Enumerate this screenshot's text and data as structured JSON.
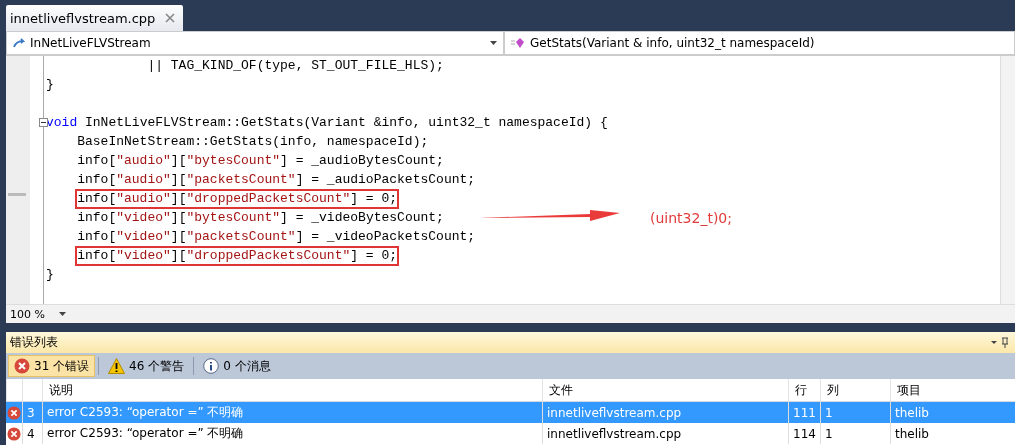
{
  "tab": {
    "title": "innetliveflvstream.cpp"
  },
  "nav": {
    "type_dropdown": "InNetLiveFLVStream",
    "member_dropdown": "GetStats(Variant & info, uint32_t namespaceId)"
  },
  "code": {
    "lines": [
      {
        "kind": "code",
        "boxed": false,
        "tokens": [
          {
            "kind": "plain",
            "text": "             || TAG_KIND_OF(type, ST_OUT_FILE_HLS);"
          }
        ]
      },
      {
        "kind": "code",
        "boxed": false,
        "tokens": [
          {
            "kind": "plain",
            "text": "}"
          }
        ]
      },
      {
        "kind": "blank"
      },
      {
        "kind": "code",
        "boxed": false,
        "collapsible": true,
        "tokens": [
          {
            "kind": "keyword",
            "text": "void"
          },
          {
            "kind": "plain",
            "text": " InNetLiveFLVStream::GetStats(Variant &info, uint32_t namespaceId) {"
          }
        ]
      },
      {
        "kind": "code",
        "boxed": false,
        "tokens": [
          {
            "kind": "plain",
            "text": "    BaseInNetStream::GetStats(info, namespaceId);"
          }
        ]
      },
      {
        "kind": "code",
        "boxed": false,
        "tokens": [
          {
            "kind": "plain",
            "text": "    info["
          },
          {
            "kind": "string",
            "text": "\"audio\""
          },
          {
            "kind": "plain",
            "text": "]["
          },
          {
            "kind": "string",
            "text": "\"bytesCount\""
          },
          {
            "kind": "plain",
            "text": "] = _audioBytesCount;"
          }
        ]
      },
      {
        "kind": "code",
        "boxed": false,
        "tokens": [
          {
            "kind": "plain",
            "text": "    info["
          },
          {
            "kind": "string",
            "text": "\"audio\""
          },
          {
            "kind": "plain",
            "text": "]["
          },
          {
            "kind": "string",
            "text": "\"packetsCount\""
          },
          {
            "kind": "plain",
            "text": "] = _audioPacketsCount;"
          }
        ]
      },
      {
        "kind": "code",
        "boxed": true,
        "tokens": [
          {
            "kind": "plain",
            "text": "info["
          },
          {
            "kind": "string",
            "text": "\"audio\""
          },
          {
            "kind": "plain",
            "text": "]["
          },
          {
            "kind": "string",
            "text": "\"droppedPacketsCount\""
          },
          {
            "kind": "plain",
            "text": "] = 0;"
          }
        ]
      },
      {
        "kind": "code",
        "boxed": false,
        "tokens": [
          {
            "kind": "plain",
            "text": "    info["
          },
          {
            "kind": "string",
            "text": "\"video\""
          },
          {
            "kind": "plain",
            "text": "]["
          },
          {
            "kind": "string",
            "text": "\"bytesCount\""
          },
          {
            "kind": "plain",
            "text": "] = _videoBytesCount;"
          }
        ]
      },
      {
        "kind": "code",
        "boxed": false,
        "tokens": [
          {
            "kind": "plain",
            "text": "    info["
          },
          {
            "kind": "string",
            "text": "\"video\""
          },
          {
            "kind": "plain",
            "text": "]["
          },
          {
            "kind": "string",
            "text": "\"packetsCount\""
          },
          {
            "kind": "plain",
            "text": "] = _videoPacketsCount;"
          }
        ]
      },
      {
        "kind": "code",
        "boxed": true,
        "tokens": [
          {
            "kind": "plain",
            "text": "info["
          },
          {
            "kind": "string",
            "text": "\"video\""
          },
          {
            "kind": "plain",
            "text": "]["
          },
          {
            "kind": "string",
            "text": "\"droppedPacketsCount\""
          },
          {
            "kind": "plain",
            "text": "] = 0;"
          }
        ]
      },
      {
        "kind": "code",
        "boxed": false,
        "tokens": [
          {
            "kind": "plain",
            "text": "}"
          }
        ]
      }
    ]
  },
  "annotation": {
    "text": "(uint32_t)0;"
  },
  "zoom": "100 %",
  "error_list": {
    "title": "错误列表",
    "filters": [
      {
        "kind": "error",
        "label": "31 个错误",
        "selected": true
      },
      {
        "kind": "warning",
        "label": "46 个警告",
        "selected": false
      },
      {
        "kind": "info",
        "label": "0 个消息",
        "selected": false
      }
    ],
    "columns": [
      "说明",
      "文件",
      "行",
      "列",
      "项目"
    ],
    "rows": [
      {
        "index": "3",
        "description": "error C2593: “operator =” 不明确",
        "file": "innetliveflvstream.cpp",
        "line": "111",
        "column": "1",
        "project": "thelib",
        "selected": true
      },
      {
        "index": "4",
        "description": "error C2593: “operator =” 不明确",
        "file": "innetliveflvstream.cpp",
        "line": "114",
        "column": "1",
        "project": "thelib",
        "selected": false
      }
    ]
  }
}
